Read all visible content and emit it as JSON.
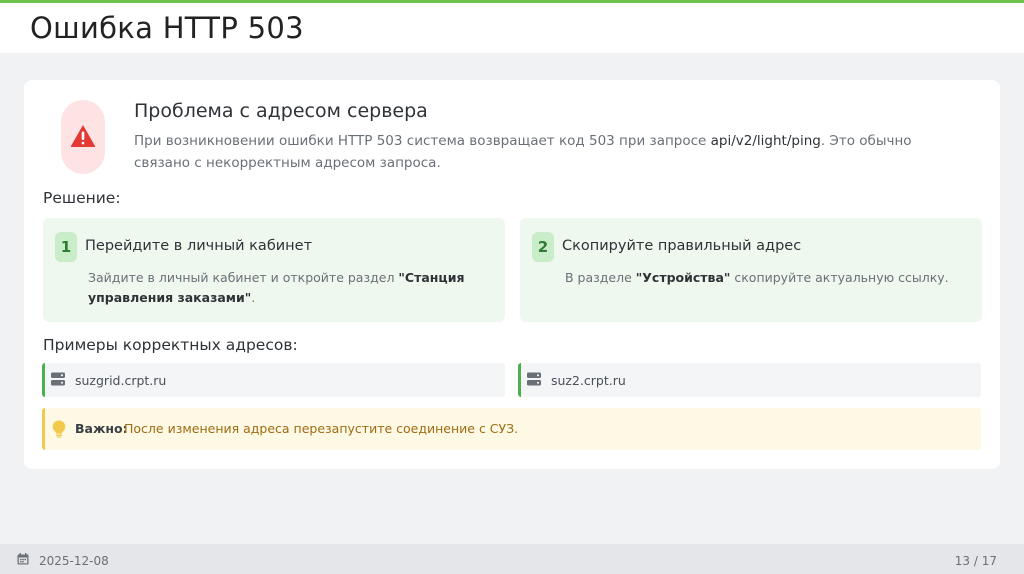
{
  "page_title": "Ошибка HTTP 503",
  "problem": {
    "title": "Проблема с адресом сервера",
    "text_before": "При возникновении ошибки HTTP 503 система возвращает код 503 при запросе ",
    "code": "api/v2/light/ping",
    "text_after": ". Это обычно связано с некорректным адресом запроса."
  },
  "solution_label": "Решение:",
  "steps": [
    {
      "number": "1",
      "title": "Перейдите в личный кабинет",
      "desc_before": "Зайдите в личный кабинет и откройте раздел ",
      "desc_bold": "\"Станция управления заказами\"",
      "desc_after": "."
    },
    {
      "number": "2",
      "title": "Скопируйте правильный адрес",
      "desc_before": "В разделе ",
      "desc_bold": "\"Устройства\"",
      "desc_after": " скопируйте актуальную ссылку."
    }
  ],
  "examples_label": "Примеры корректных адресов:",
  "addresses": [
    "suzgrid.crpt.ru",
    "suz2.crpt.ru"
  ],
  "notice": {
    "label": "Важно:",
    "text": "После изменения адреса перезапустите соединение с СУЗ."
  },
  "footer": {
    "date": "2025-12-08",
    "page": "13 / 17"
  },
  "colors": {
    "accent": "#6cc24a",
    "alert_red": "#e53935",
    "step_bg": "#eef8ee",
    "notice_border": "#f2c94c",
    "notice_text": "#a06b12"
  }
}
